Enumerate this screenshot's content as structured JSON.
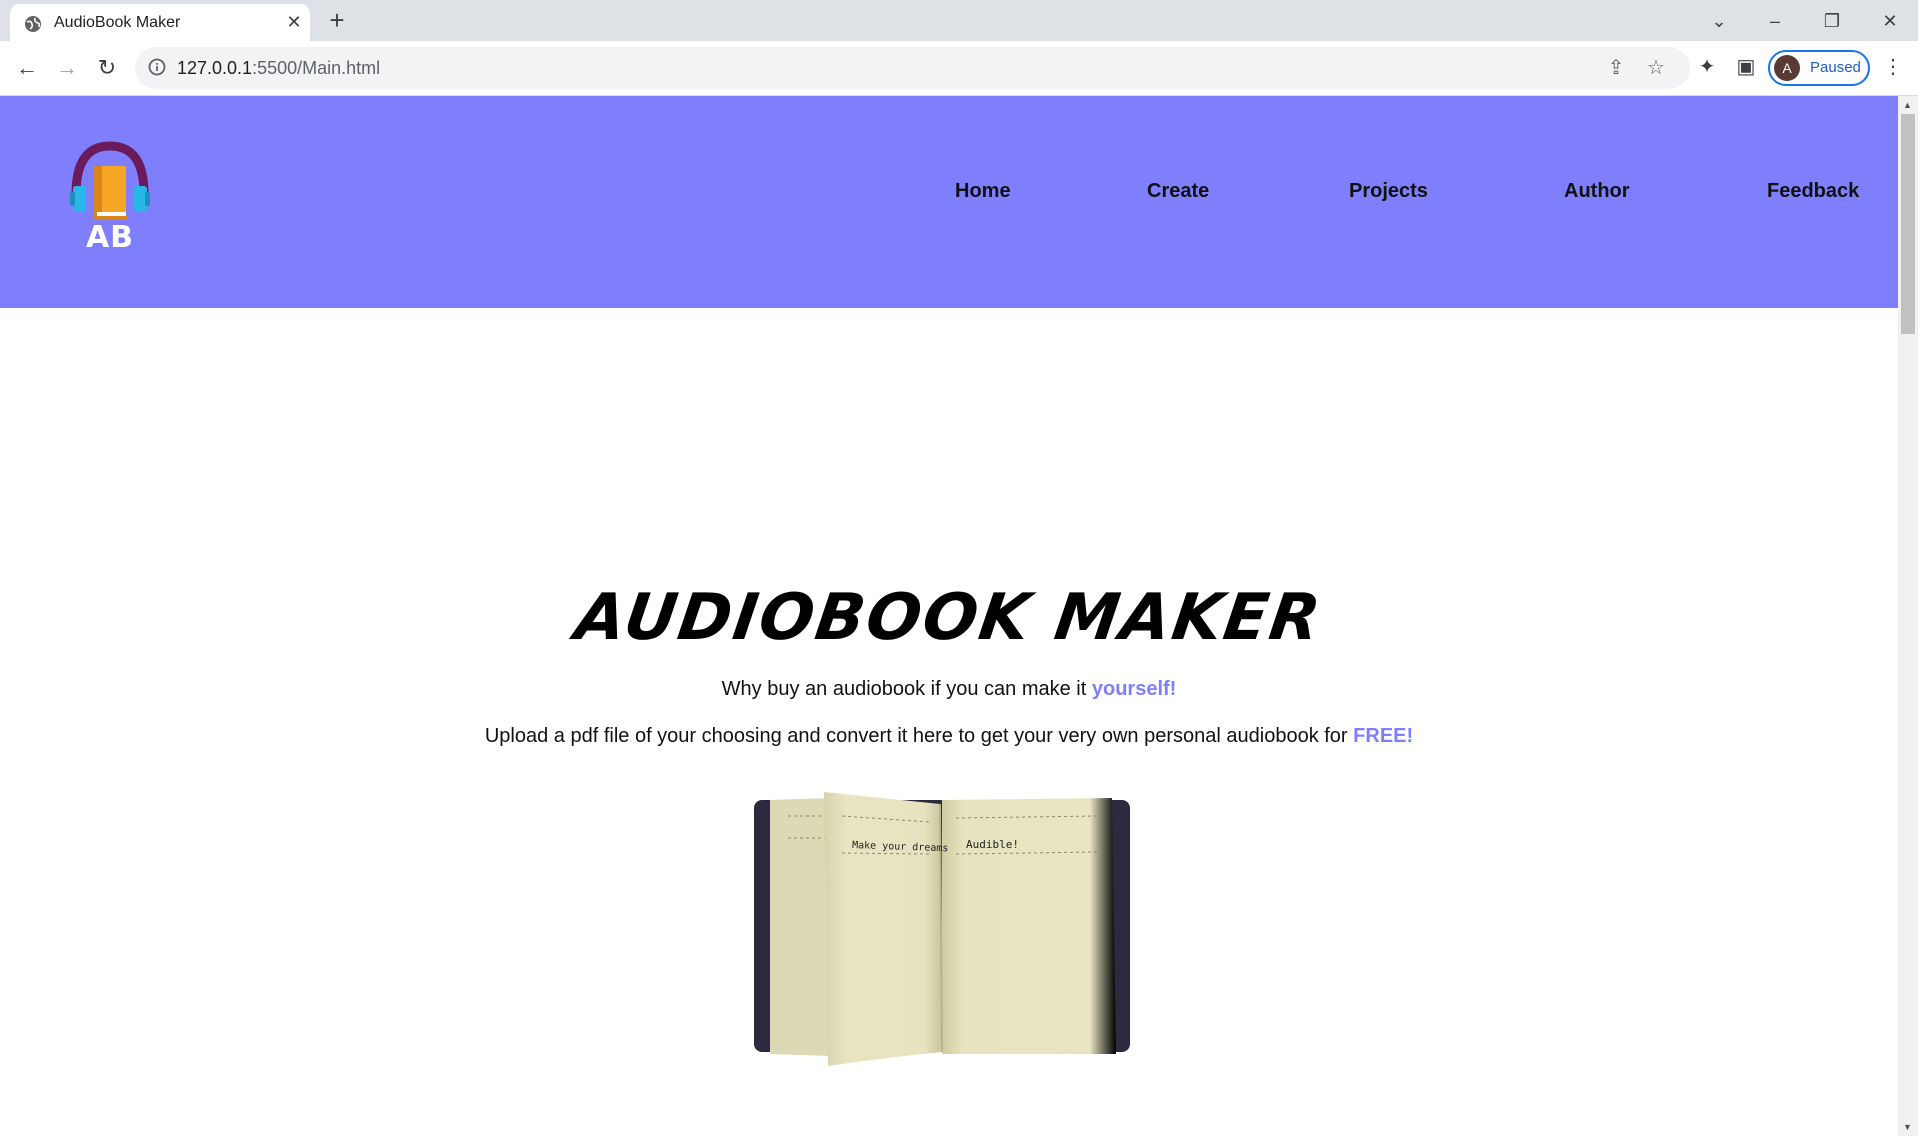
{
  "browser": {
    "tab_title": "AudioBook Maker",
    "url_host": "127.0.0.1",
    "url_rest": ":5500/Main.html",
    "profile_initial": "A",
    "profile_status": "Paused"
  },
  "header": {
    "logo_text": "AB",
    "nav": [
      "Home",
      "Create",
      "Projects",
      "Author",
      "Feedback"
    ],
    "background_color": "#7f7ffe"
  },
  "hero": {
    "title": "AUDIOBOOK MAKER",
    "line1_prefix": "Why buy an audiobook if you can make it ",
    "line1_accent": "yourself!",
    "line2_prefix": "Upload a pdf file of your choosing and convert it here to get your very own personal audiobook for ",
    "line2_accent": "FREE!",
    "book_text_left": "Make your dreams",
    "book_text_right": "Audible!",
    "accent_color": "#7f7ffe"
  }
}
